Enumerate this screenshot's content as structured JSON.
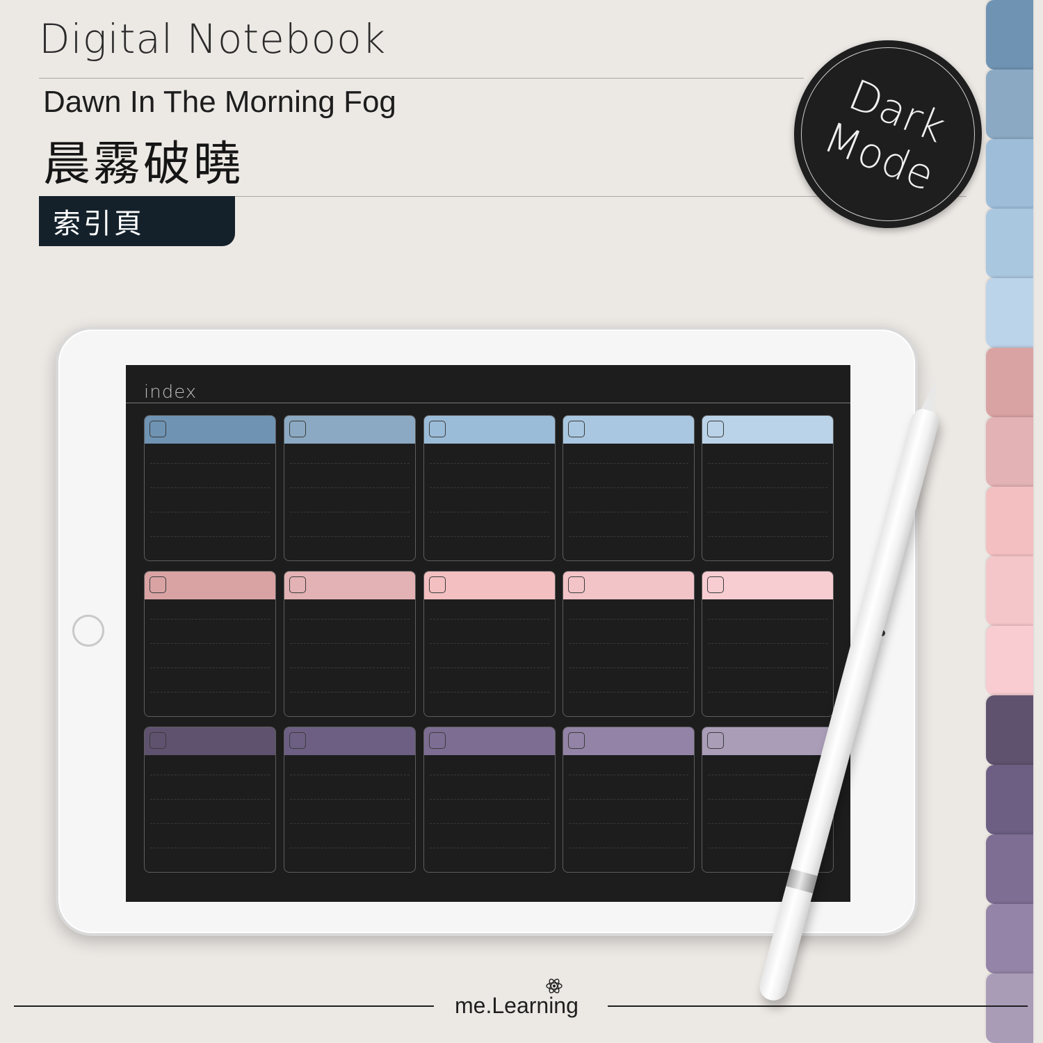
{
  "header": {
    "title": "Digital Notebook",
    "subtitle": "Dawn In The Morning Fog",
    "title_zh": "晨霧破曉",
    "page_tag": "索引頁"
  },
  "badge": {
    "line1": "Dark",
    "line2": "Mode"
  },
  "side_tabs": [
    "#6f93b3",
    "#8ba9c2",
    "#9dbdd9",
    "#aac7e0",
    "#bcd4e9",
    "#d9a3a4",
    "#e3b2b4",
    "#f3bfc0",
    "#f4c6c9",
    "#f8ccd0",
    "#5f526f",
    "#6d5f83",
    "#7e6e93",
    "#9484a7",
    "#a99cb7"
  ],
  "screen": {
    "title": "index",
    "card_colors": [
      "#6f93b3",
      "#8ba9c2",
      "#9bbcd8",
      "#a9c7e0",
      "#bad3e8",
      "#d9a3a4",
      "#e3b2b4",
      "#f3bfc0",
      "#f2c3c7",
      "#f7cdd1",
      "#5f526f",
      "#6c5f83",
      "#7d6d93",
      "#9383a6",
      "#aa9db8"
    ]
  },
  "footer": {
    "brand": "me.Learning"
  }
}
